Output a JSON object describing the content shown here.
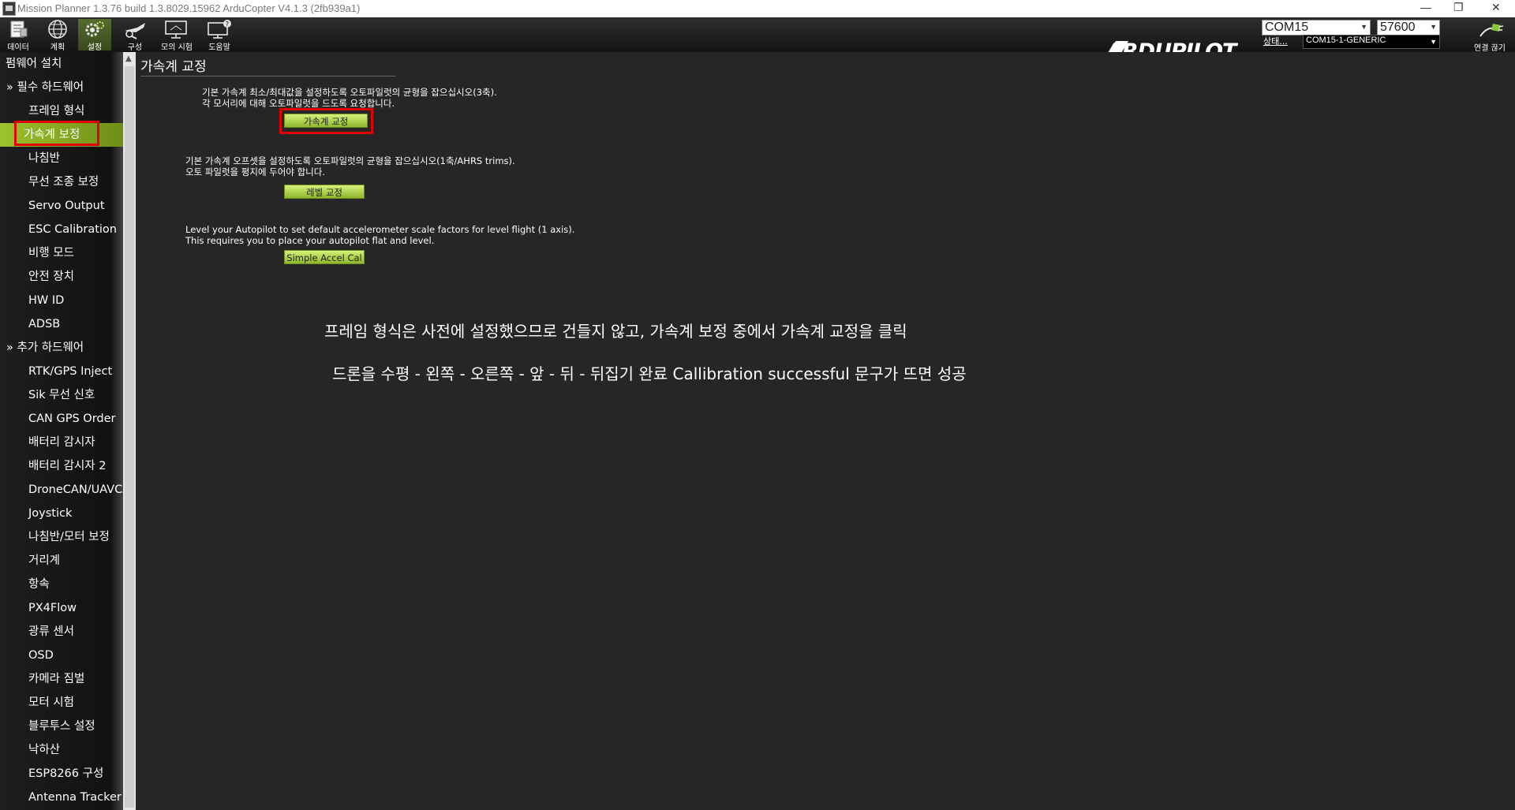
{
  "window": {
    "title": "Mission Planner 1.3.76 build 1.3.8029.15962 ArduCopter V4.1.3 (2fb939a1)",
    "minimize": "—",
    "restore": "❐",
    "close": "✕"
  },
  "toolbar": {
    "buttons": [
      {
        "label": "데이터",
        "icon": "data-icon"
      },
      {
        "label": "계획",
        "icon": "globe-icon"
      },
      {
        "label": "설정",
        "icon": "gear-icon"
      },
      {
        "label": "구성",
        "icon": "wrench-plane-icon"
      },
      {
        "label": "모의 시험",
        "icon": "monitor-icon"
      },
      {
        "label": "도움말",
        "icon": "help-monitor-icon"
      }
    ],
    "logo_text": "ARDUPILOT",
    "port": "COM15",
    "baud": "57600",
    "status_link": "상태...",
    "port_detail": "COM15-1-GENERIC",
    "disconnect_label": "연결 끊기"
  },
  "sidebar": {
    "top": "펌웨어 설치",
    "items": [
      {
        "label": "필수 하드웨어",
        "header": true
      },
      {
        "label": "프레임 형식"
      },
      {
        "label": "가속계 보정",
        "selected": true
      },
      {
        "label": "나침반"
      },
      {
        "label": "무선 조종 보정"
      },
      {
        "label": "Servo Output"
      },
      {
        "label": "ESC Calibration"
      },
      {
        "label": "비행 모드"
      },
      {
        "label": "안전 장치"
      },
      {
        "label": "HW ID"
      },
      {
        "label": "ADSB"
      },
      {
        "label": "추가 하드웨어",
        "header": true
      },
      {
        "label": "RTK/GPS Inject"
      },
      {
        "label": "Sik 무선 신호"
      },
      {
        "label": "CAN GPS Order"
      },
      {
        "label": "배터리 감시자"
      },
      {
        "label": "배터리 감시자 2"
      },
      {
        "label": "DroneCAN/UAVCAN"
      },
      {
        "label": "Joystick"
      },
      {
        "label": "나침반/모터 보정"
      },
      {
        "label": "거리계"
      },
      {
        "label": "항속"
      },
      {
        "label": "PX4Flow"
      },
      {
        "label": "광류 센서"
      },
      {
        "label": "OSD"
      },
      {
        "label": "카메라 짐벌"
      },
      {
        "label": "모터 시험"
      },
      {
        "label": "블루투스 설정"
      },
      {
        "label": "낙하산"
      },
      {
        "label": "ESP8266 구성"
      },
      {
        "label": "Antenna Tracker"
      }
    ]
  },
  "main": {
    "title": "가속계 교정",
    "sections": [
      {
        "line1": "기본 가속계 최소/최대값을 설정하도록 오토파일럿의 균형을 잡으십시오(3축).",
        "line2": "각 모서리에 대해 오토파일럿을 드도록 요청합니다.",
        "button": "가속계 교정"
      },
      {
        "line1": "기본 가속계 오프셋을 설정하도록 오토파일럿의 균형을 잡으십시오(1축/AHRS trims).",
        "line2": "오토 파일럿을 평지에 두어야 합니다.",
        "button": "레벨 교정"
      },
      {
        "line1": "Level your Autopilot to set default accelerometer scale factors for level flight (1 axis).",
        "line2": "This requires you to place your autopilot flat and level.",
        "button": "Simple Accel Cal"
      }
    ],
    "annotation1": "프레임 형식은 사전에 설정했으므로 건들지 않고, 가속계 보정 중에서 가속계 교정을 클릭",
    "annotation2": "드론을 수평 - 왼쪽 - 오른쪽 - 앞 - 뒤 - 뒤집기 완료 Callibration successful 문구가 뜨면 성공"
  },
  "colors": {
    "accent_green": "#9cc22c",
    "highlight_red": "#e00000",
    "background": "#262626"
  }
}
